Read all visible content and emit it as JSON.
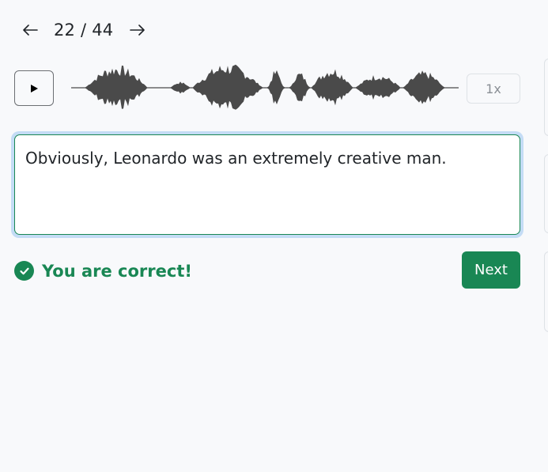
{
  "pager": {
    "current": "22",
    "separator": "/",
    "total": "44",
    "prev_icon": "arrow-left-icon",
    "next_icon": "arrow-right-icon"
  },
  "player": {
    "play_icon": "play-icon",
    "speed_label": "1x",
    "waveform_color": "#4a4a4a"
  },
  "answer": {
    "text": "Obviously, Leonardo was an extremely creative man."
  },
  "result": {
    "icon": "check-circle-icon",
    "message": "You are correct!",
    "color": "#198754"
  },
  "actions": {
    "next_label": "Next"
  }
}
